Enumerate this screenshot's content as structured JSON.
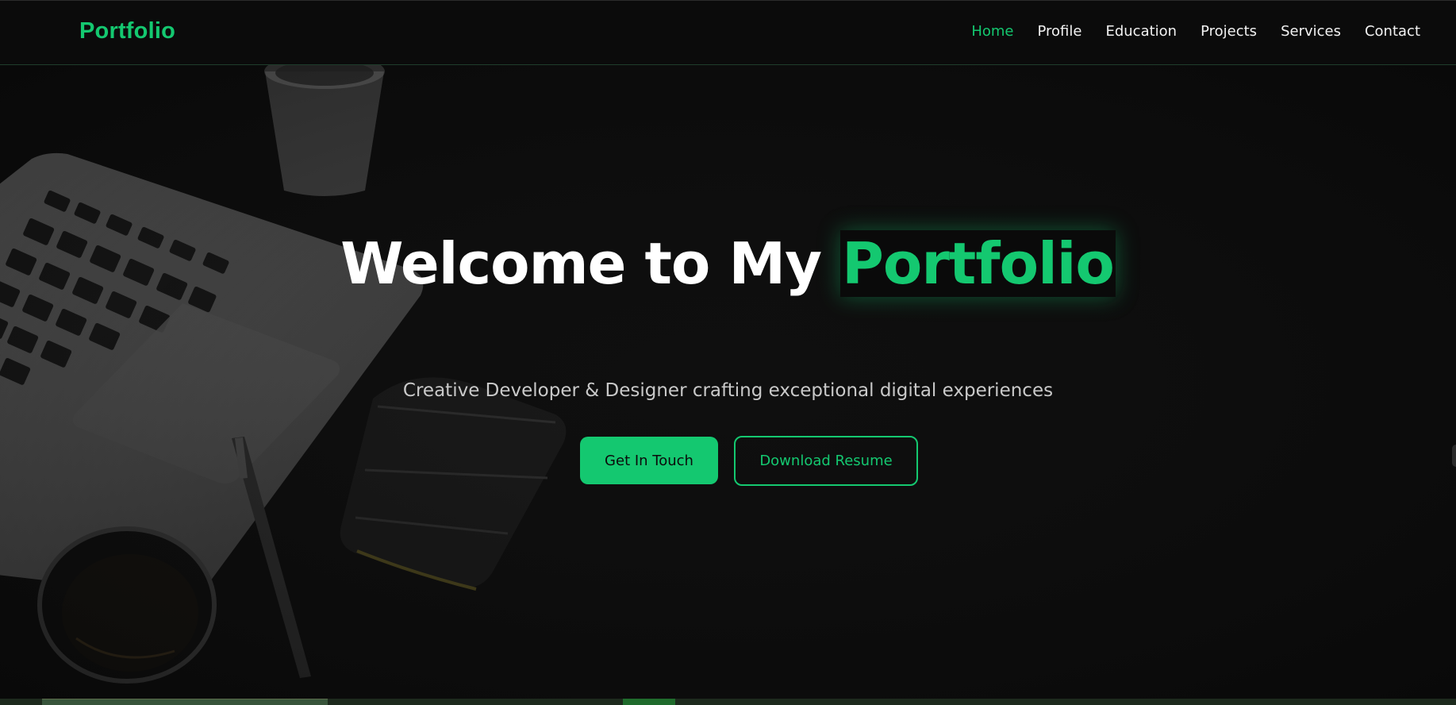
{
  "nav": {
    "brand": "Portfolio",
    "links": [
      "Home",
      "Profile",
      "Education",
      "Projects",
      "Services",
      "Contact"
    ],
    "active": "Home"
  },
  "hero": {
    "title_prefix": "Welcome to My",
    "title_highlight": "Portfolio",
    "subtitle": "Creative Developer & Designer crafting exceptional digital experiences",
    "primary_button": "Get In Touch",
    "secondary_button": "Download Resume"
  },
  "colors": {
    "accent": "#14c870",
    "background": "#0c0c0c",
    "nav_text": "#f2f2f2",
    "subtitle_text": "#c9c9c9"
  },
  "icons": {
    "hero_background": "desk-laptop-photo"
  }
}
